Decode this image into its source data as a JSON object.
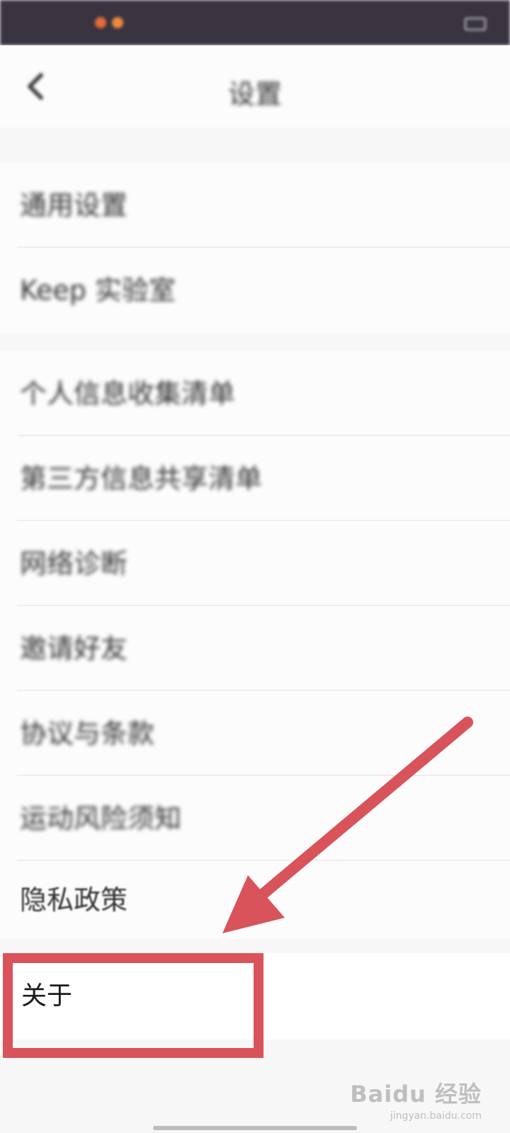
{
  "header": {
    "title": "设置"
  },
  "group1": {
    "items": [
      {
        "label": "通用设置"
      },
      {
        "label": "Keep 实验室"
      }
    ]
  },
  "group2": {
    "items": [
      {
        "label": "个人信息收集清单"
      },
      {
        "label": "第三方信息共享清单"
      },
      {
        "label": "网络诊断"
      },
      {
        "label": "邀请好友"
      },
      {
        "label": "协议与条款"
      },
      {
        "label": "运动风险须知"
      },
      {
        "label": "隐私政策"
      }
    ]
  },
  "about": {
    "label": "关于"
  },
  "watermark": {
    "brand": "Baidu 经验",
    "url": "jingyan.baidu.com"
  },
  "colors": {
    "status_bar": "#3a3340",
    "annotation": "#d9535b",
    "background": "#f7f7f7"
  },
  "icons": {
    "back": "chevron-left-icon",
    "annotation_arrow": "arrow-icon"
  }
}
